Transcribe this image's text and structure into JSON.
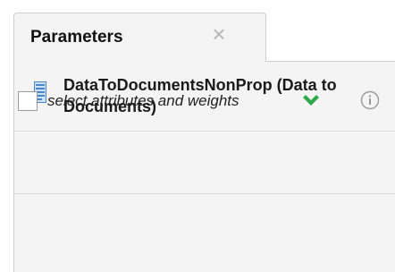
{
  "tab": {
    "title": "Parameters",
    "close_glyph": "×"
  },
  "operator": {
    "icon": "document-icon",
    "title": "DataToDocumentsNonProp (Data to Documents)"
  },
  "parameters": [
    {
      "checked": false,
      "label": "select attributes and weights",
      "status_icon": "check-chevron-icon",
      "status_color": "#2ea84a",
      "help_icon": "info-icon"
    }
  ]
}
